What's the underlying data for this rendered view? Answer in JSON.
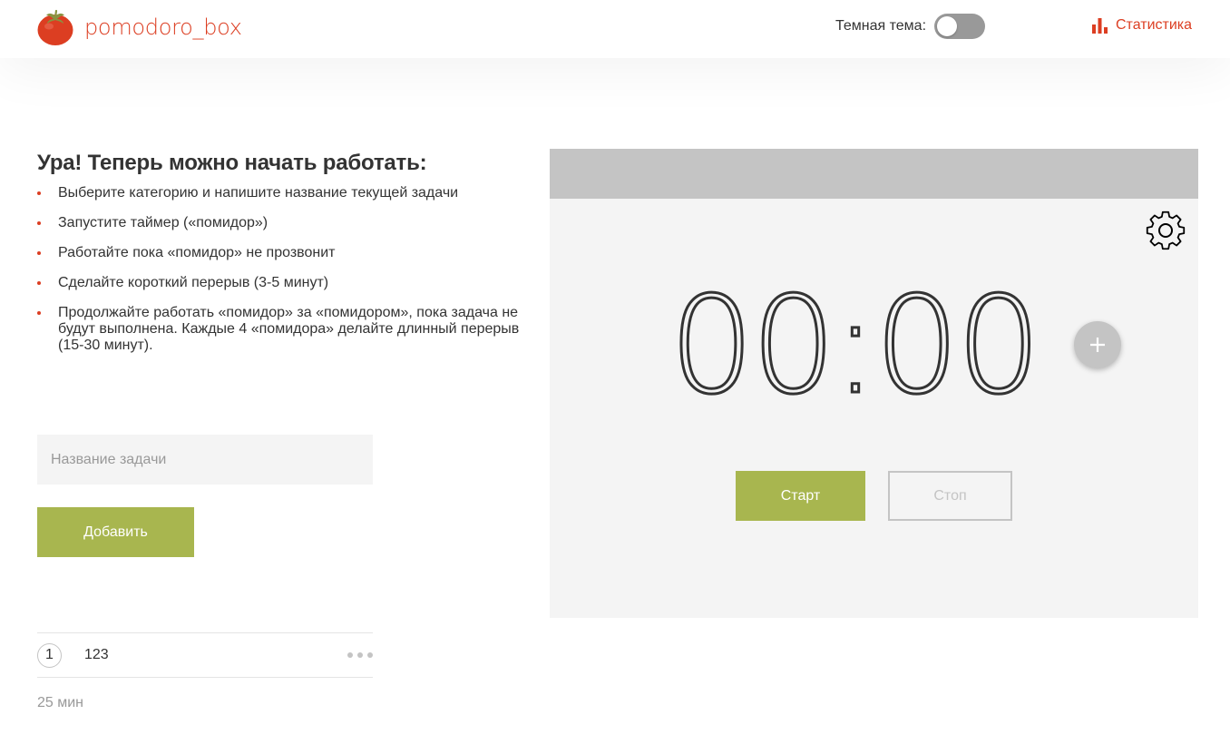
{
  "header": {
    "logo_text": "pomodoro_box",
    "logo_icon": "tomato-icon",
    "theme_label": "Темная тема:",
    "theme_dark_enabled": false,
    "stats_label": "Статистика",
    "stats_icon": "bar-chart-icon"
  },
  "intro": {
    "title": "Ура! Теперь можно начать работать:",
    "steps": [
      "Выберите категорию и напишите название текущей задачи",
      "Запустите таймер («помидор»)",
      "Работайте пока «помидор» не прозвонит",
      "Сделайте короткий перерыв (3-5 минут)",
      "Продолжайте работать «помидор» за «помидором», пока задача не будут выполнена. Каждые 4 «помидора» делайте длинный перерыв (15-30 минут)."
    ]
  },
  "task_form": {
    "input_placeholder": "Название задачи",
    "input_value": "",
    "add_label": "Добавить"
  },
  "tasks": [
    {
      "count": "1",
      "name": "123"
    }
  ],
  "total_time": "25 мин",
  "timer": {
    "time": "00:00",
    "settings_icon": "gear-icon",
    "plus_icon": "plus-icon",
    "start_label": "Старт",
    "stop_label": "Стоп"
  },
  "colors": {
    "accent_red": "#DC3E22",
    "accent_green": "#A8B64F",
    "gray_light": "#F4F4F4",
    "gray_mid": "#C4C4C4",
    "toggle_off": "#999999"
  }
}
